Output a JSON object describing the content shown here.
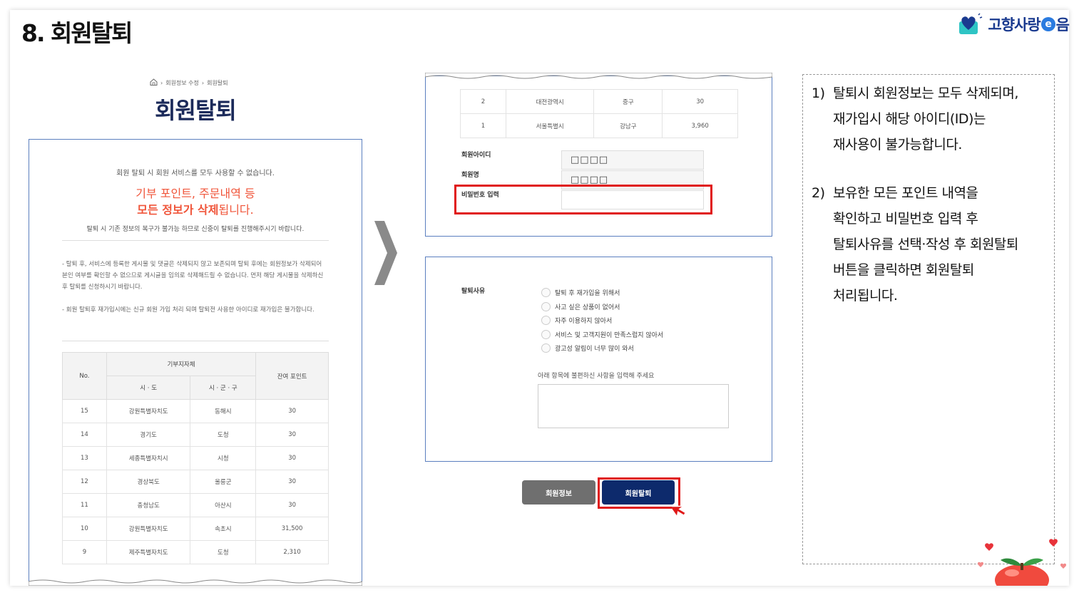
{
  "slide": {
    "title": "8. 회원탈퇴"
  },
  "logo": {
    "text_before": "고향사랑",
    "e_letter": "e",
    "text_after": "음"
  },
  "colors": {
    "brand_navy": "#0d2a6c",
    "warning": "#f0553a",
    "highlight": "#e01818",
    "frame": "#5b7fbf"
  },
  "left_panel": {
    "breadcrumb": [
      "회원정보 수정",
      "회원탈퇴"
    ],
    "heading": "회원탈퇴",
    "notice": "회원 탈퇴 시 회원 서비스를 모두 사용할 수 없습니다.",
    "warning_line1": "기부 포인트, 주문내역 등",
    "warning_bold": "모든 정보가 삭제",
    "warning_rest": "됩니다.",
    "sub_notice": "탈퇴 시 기존 정보의 복구가 불가능 하므로 신중이 탈퇴를 진행해주시기 바랍니다.",
    "bullet1": "- 탈퇴 후, 서비스에 등록한 게시물 및 댓글은 삭제되지 않고 보존되며 탈퇴 후에는 회원정보가 삭제되어 본인 여부를 확인할 수 없으므로 게시글을 임의로 삭제해드릴 수 없습니다. 먼저 해당 게시물을 삭제하신 후 탈퇴를 신청하시기 바랍니다.",
    "bullet2": "- 회원 탈퇴후 재가입시에는 신규 회원 가입 처리 되며 탈퇴전 사용한 아이디로 재가입은 불가합니다.",
    "table": {
      "h_no": "No.",
      "h_group": "기부지자체",
      "h_sido": "시 · 도",
      "h_sigungu": "시 · 군 · 구",
      "h_points": "잔여 포인트",
      "rows": [
        {
          "no": "15",
          "sido": "강원특별자치도",
          "sigungu": "동해시",
          "points": "30"
        },
        {
          "no": "14",
          "sido": "경기도",
          "sigungu": "도청",
          "points": "30"
        },
        {
          "no": "13",
          "sido": "세종특별자치시",
          "sigungu": "시청",
          "points": "30"
        },
        {
          "no": "12",
          "sido": "경상북도",
          "sigungu": "울릉군",
          "points": "30"
        },
        {
          "no": "11",
          "sido": "충청남도",
          "sigungu": "아산시",
          "points": "30"
        },
        {
          "no": "10",
          "sido": "강원특별자치도",
          "sigungu": "속초시",
          "points": "31,500"
        },
        {
          "no": "9",
          "sido": "제주특별자치도",
          "sigungu": "도청",
          "points": "2,310"
        }
      ]
    }
  },
  "mid_top": {
    "rows": [
      {
        "no": "2",
        "sido": "대전광역시",
        "sigungu": "중구",
        "points": "30"
      },
      {
        "no": "1",
        "sido": "서울특별시",
        "sigungu": "강남구",
        "points": "3,960"
      }
    ],
    "id_label": "회원아이디",
    "id_value": "□□□□",
    "name_label": "회원명",
    "name_value": "□□□□",
    "pw_label": "비밀번호 입력",
    "pw_value": ""
  },
  "mid_bot": {
    "reason_label": "탈퇴사유",
    "reasons": [
      "탈퇴 후 재가입을 위해서",
      "사고 싶은 상품이 없어서",
      "자주 이용하지 않아서",
      "서비스 및 고객지원이 만족스럽지 않아서",
      "광고성 알림이 너무 많이 와서"
    ],
    "memo_label": "아래 항목에 불편하신 사항을 입력해 주세요",
    "memo_value": ""
  },
  "buttons": {
    "info": "회원정보",
    "withdraw": "회원탈퇴"
  },
  "instructions": {
    "item1": {
      "num": "1)",
      "lines": [
        "탈퇴시 회원정보는 모두 삭제되며,",
        "재가입시 해당 아이디(ID)는",
        "재사용이 불가능합니다."
      ]
    },
    "item2": {
      "num": "2)",
      "lines": [
        "보유한 모든 포인트 내역을",
        "확인하고 비밀번호 입력 후",
        "탈퇴사유를 선택·작성 후 회원탈퇴",
        "버튼을 클릭하면 회원탈퇴",
        "처리됩니다."
      ]
    }
  }
}
